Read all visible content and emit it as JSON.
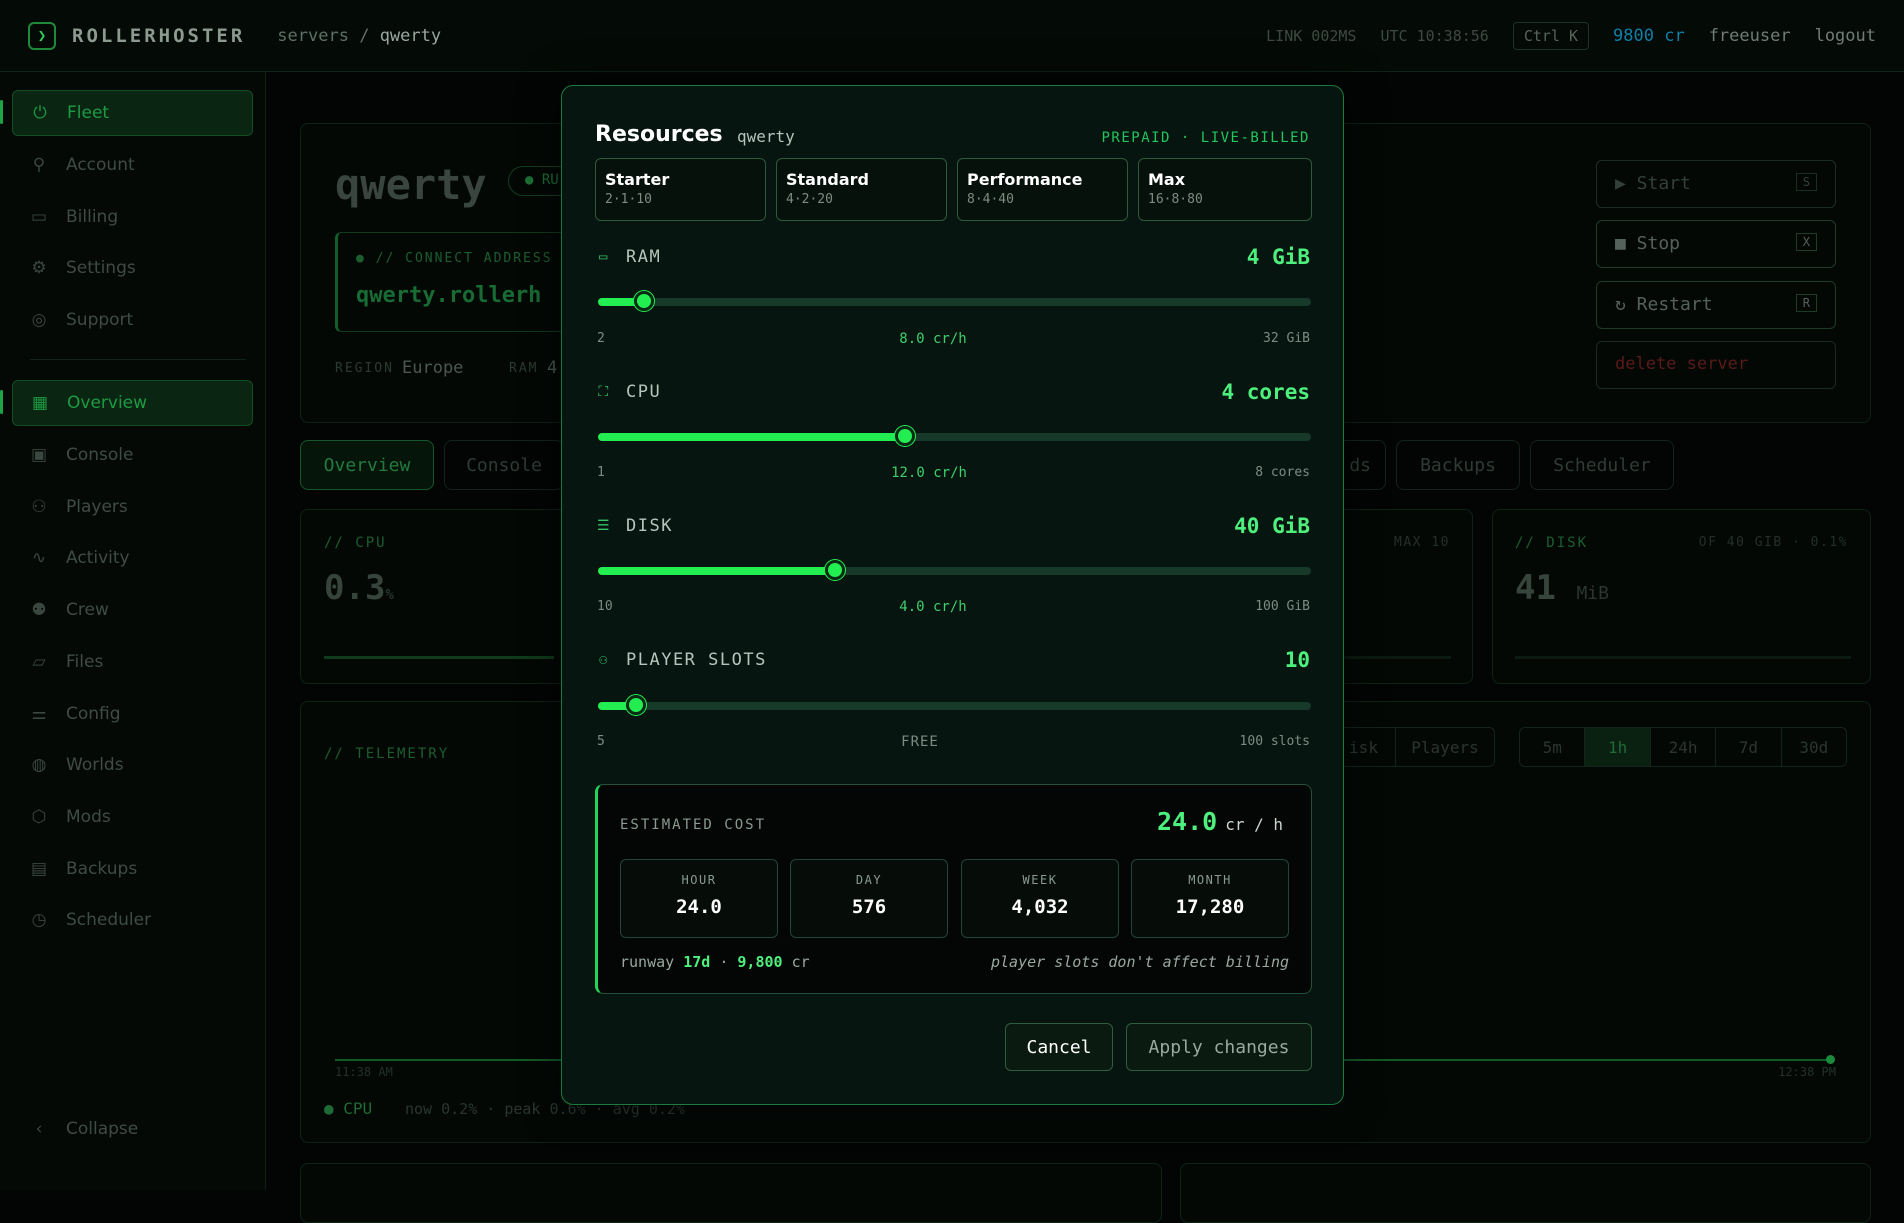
{
  "topbar": {
    "logo_glyph": "❯",
    "brand": "ROLLERHOSTER",
    "crumb_root": "servers",
    "crumb_sep": "/",
    "crumb_current": "qwerty",
    "link": "LINK 002MS",
    "utc": "UTC 10:38:56",
    "shortcut": "Ctrl K",
    "credits": "9800 cr",
    "user": "freeuser",
    "logout": "logout"
  },
  "sidebar": {
    "top_items": [
      {
        "label": "Fleet",
        "icon": "power-icon"
      },
      {
        "label": "Account",
        "icon": "user-icon"
      },
      {
        "label": "Billing",
        "icon": "card-icon"
      },
      {
        "label": "Settings",
        "icon": "gear-icon"
      },
      {
        "label": "Support",
        "icon": "lifebuoy-icon"
      }
    ],
    "server_items": [
      {
        "label": "Overview",
        "icon": "grid-icon"
      },
      {
        "label": "Console",
        "icon": "terminal-icon"
      },
      {
        "label": "Players",
        "icon": "users-icon"
      },
      {
        "label": "Activity",
        "icon": "pulse-icon"
      },
      {
        "label": "Crew",
        "icon": "crew-icon"
      },
      {
        "label": "Files",
        "icon": "folder-icon"
      },
      {
        "label": "Config",
        "icon": "sliders-icon"
      },
      {
        "label": "Worlds",
        "icon": "globe-icon"
      },
      {
        "label": "Mods",
        "icon": "puzzle-icon"
      },
      {
        "label": "Backups",
        "icon": "save-icon"
      },
      {
        "label": "Scheduler",
        "icon": "timer-icon"
      }
    ],
    "collapse": "Collapse"
  },
  "background": {
    "server_name": "qwerty",
    "status": "RU",
    "connect_label": "// CONNECT ADDRESS",
    "connect_value": "qwerty.rollerh",
    "region_label": "REGION",
    "region_value": "Europe",
    "ram_label": "RAM",
    "ram_value": "4",
    "actions": {
      "start": "▶ Start",
      "start_key": "S",
      "stop": "■ Stop",
      "stop_key": "X",
      "restart": "↻ Restart",
      "restart_key": "R",
      "delete": "delete server"
    },
    "tabs": [
      "Overview",
      "Console",
      "ds",
      "Backups",
      "Scheduler"
    ],
    "cpu_label": "// CPU",
    "cpu_value": "0.3",
    "cpu_unit": "%",
    "slots_max": "MAX 10",
    "disk_label": "// DISK",
    "disk_meta": "OF 40 GIB · 0.1%",
    "disk_value": "41",
    "disk_unit": "MiB",
    "telemetry_label": "// TELEMETRY",
    "metric_tabs": [
      "isk",
      "Players"
    ],
    "range_tabs": [
      "5m",
      "1h",
      "24h",
      "7d",
      "30d"
    ],
    "time_start": "11:38 AM",
    "time_end": "12:38 PM",
    "legend": "CPU",
    "legend_stats": "now 0.2% · peak 0.6% · avg 0.2%"
  },
  "modal": {
    "title": "Resources",
    "subtitle": "qwerty",
    "badge": "PREPAID · LIVE-BILLED",
    "presets": [
      {
        "name": "Starter",
        "spec": "2·1·10"
      },
      {
        "name": "Standard",
        "spec": "4·2·20"
      },
      {
        "name": "Performance",
        "spec": "8·4·40"
      },
      {
        "name": "Max",
        "spec": "16·8·80"
      }
    ],
    "resources": [
      {
        "key": "ram",
        "label": "RAM",
        "icon": "memory-icon",
        "glyph": "▭",
        "value": "4 GiB",
        "min": "2",
        "max": "32 GiB",
        "rate": "8.0 cr/h",
        "level": 0.065
      },
      {
        "key": "cpu",
        "label": "CPU",
        "icon": "chip-icon",
        "glyph": "⛶",
        "value": "4 cores",
        "min": "1",
        "max": "8 cores",
        "rate": "12.0 cr/h",
        "level": 0.43
      },
      {
        "key": "disk",
        "label": "DISK",
        "icon": "database-icon",
        "glyph": "☰",
        "value": "40 GiB",
        "min": "10",
        "max": "100 GiB",
        "rate": "4.0 cr/h",
        "level": 0.333
      },
      {
        "key": "slots",
        "label": "PLAYER SLOTS",
        "icon": "users-icon",
        "glyph": "⚇",
        "value": "10",
        "min": "5",
        "max": "100 slots",
        "rate": "FREE",
        "level": 0.053
      }
    ],
    "cost": {
      "label": "ESTIMATED COST",
      "rate": "24.0",
      "rate_unit": "cr / h",
      "boxes": [
        {
          "label": "HOUR",
          "value": "24.0"
        },
        {
          "label": "DAY",
          "value": "576"
        },
        {
          "label": "WEEK",
          "value": "4,032"
        },
        {
          "label": "MONTH",
          "value": "17,280"
        }
      ],
      "runway_prefix": "runway",
      "runway_days": "17d",
      "runway_sep": "·",
      "runway_balance": "9,800",
      "runway_unit": "cr",
      "note": "player slots don't affect billing"
    },
    "cancel": "Cancel",
    "apply": "Apply changes"
  },
  "colors": {
    "accent": "#22ee52",
    "value": "#4ef07d",
    "credits": "#0f7fa8",
    "danger": "#7a1f1f"
  }
}
